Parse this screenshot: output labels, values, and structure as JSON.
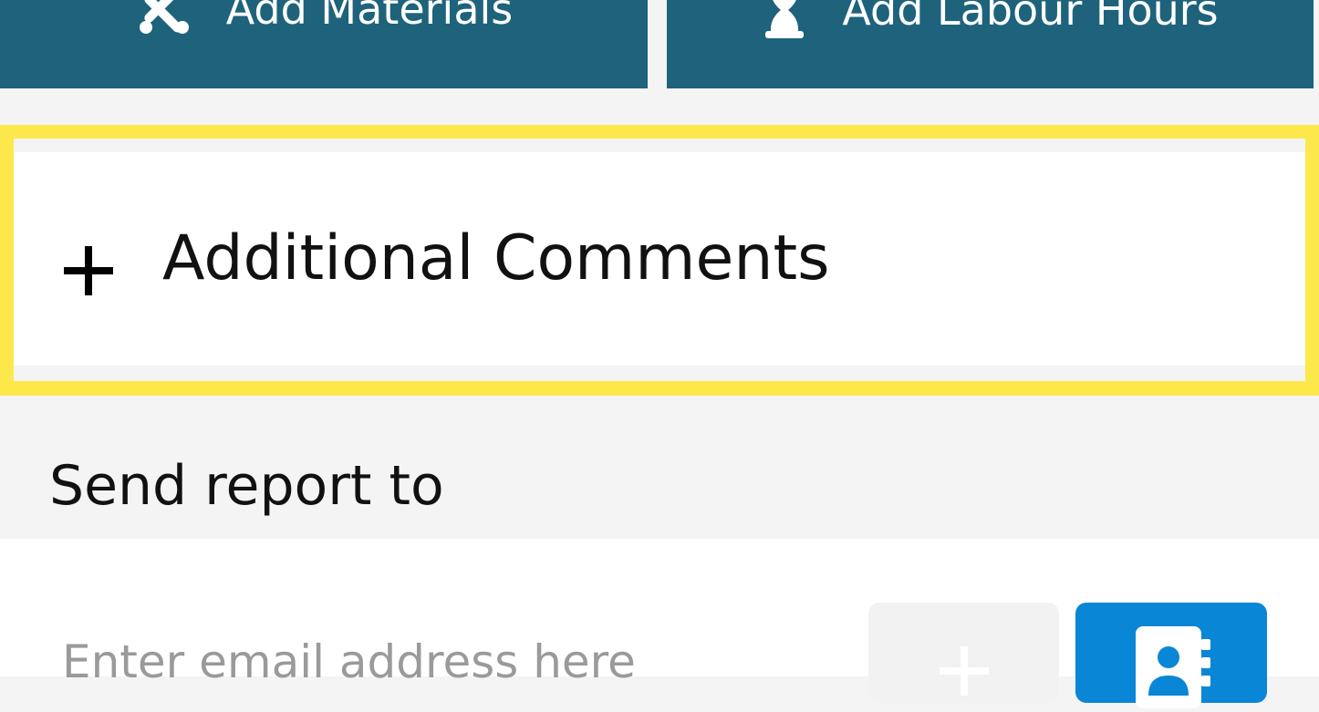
{
  "actions": {
    "materials_label": "Add Materials",
    "labour_label": "Add Labour Hours"
  },
  "comments": {
    "label": "Additional Comments"
  },
  "send_report": {
    "label": "Send report to",
    "email_placeholder": "Enter email address here"
  },
  "icons": {
    "materials": "tools-icon",
    "labour": "hourglass-icon",
    "comments_toggle": "plus-icon",
    "add_email": "plus-icon",
    "contacts": "address-book-icon"
  },
  "colors": {
    "action_button": "#1e637b",
    "highlight_border": "#fde84c",
    "contacts_button": "#0a86d6",
    "background": "#f4f4f4"
  }
}
